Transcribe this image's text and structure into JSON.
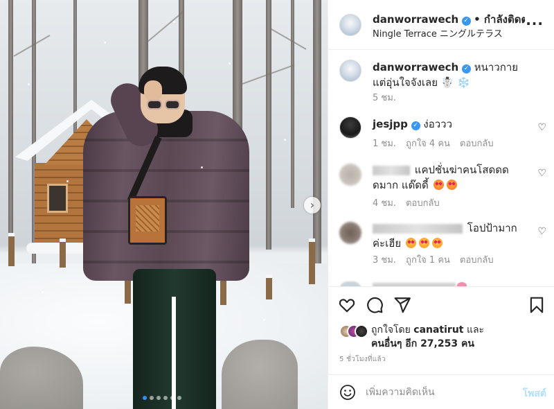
{
  "post": {
    "author": "danworrawech",
    "follow_label": "• กำลังติดตา",
    "location": "Ningle Terrace ニングルテラス",
    "more_icon": "more-horizontal-icon"
  },
  "caption": {
    "username": "danworrawech",
    "text": "หนาวกายแต่อุ่นใจจังเลย ☃️ ❄️",
    "time": "5 ชม."
  },
  "comments": [
    {
      "username": "jesjpp",
      "text": "ง่อววว",
      "time": "1 ชม.",
      "likes": "ถูกใจ 4 คน",
      "reply": "ตอบกลับ"
    },
    {
      "username_blurred": true,
      "text": "แคปชั่นฆ่าคนโสดดดดมาก แด๊ดดี้",
      "time": "4 ชม.",
      "reply": "ตอบกลับ"
    },
    {
      "username_blurred": true,
      "text": "โอปป้ามากค่ะเฮีย",
      "time": "3 ชม.",
      "likes": "ถูกใจ 1 คน",
      "reply": "ตอบกลับ"
    }
  ],
  "likes": {
    "prefix": "ถูกใจโดย",
    "liker": "canatirut",
    "connector": "และ",
    "others": "คนอื่นๆ อีก 27,253 คน"
  },
  "timestamp": "5 ชั่วโมงที่แล้ว",
  "add_comment": {
    "placeholder": "เพิ่มความคิดเห็น",
    "post_label": "โพสต์"
  },
  "carousel": {
    "slide_count": 6,
    "active_index": 0
  },
  "colors": {
    "verified": "#3897f0",
    "carousel_active_dot": "#2e8ff0",
    "post_button_disabled": "#b2dffc"
  }
}
